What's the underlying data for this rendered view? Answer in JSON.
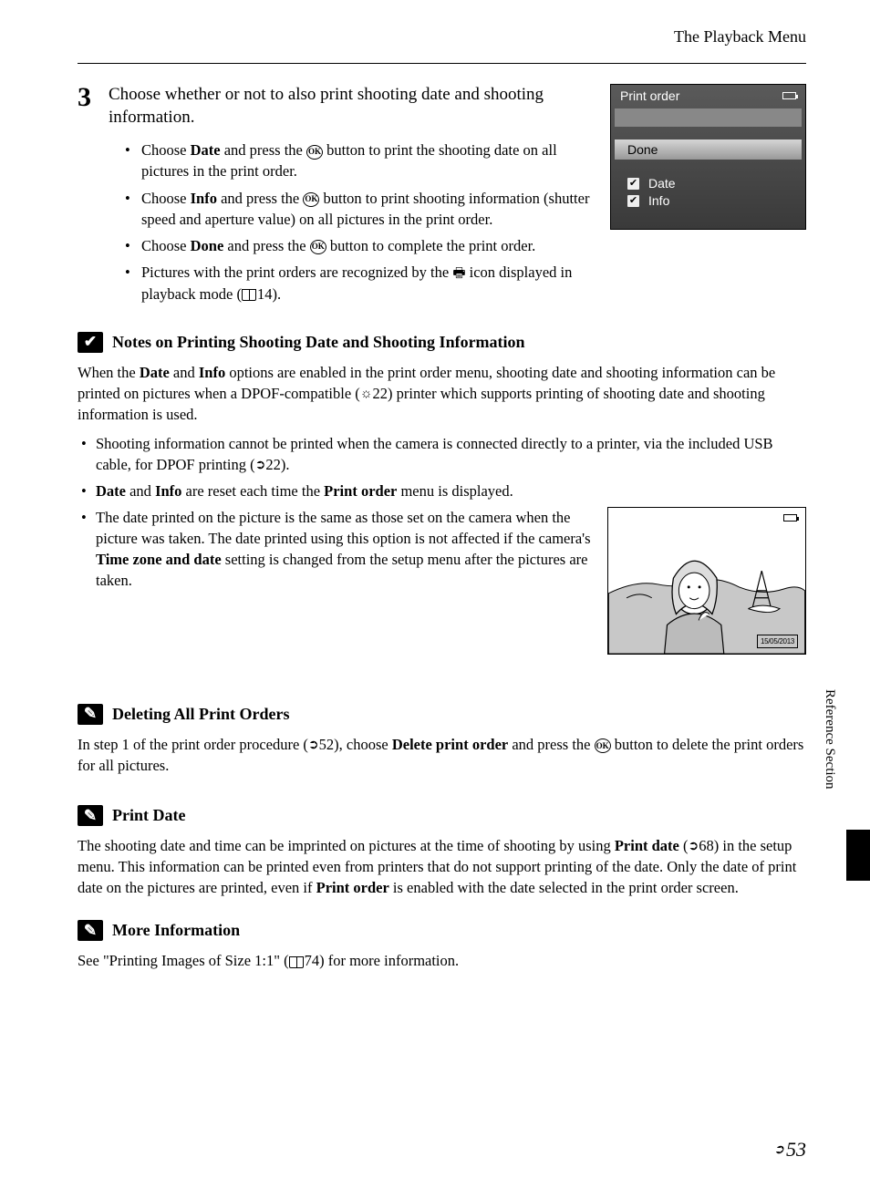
{
  "header": {
    "title": "The Playback Menu"
  },
  "sideTab": "Reference Section",
  "pageNum": "53",
  "step": {
    "number": "3",
    "title": "Choose whether or not to also print shooting date and shooting information.",
    "bullets": {
      "b1_pre": "Choose ",
      "b1_bold": "Date",
      "b1_mid": " and press the ",
      "b1_post": " button to print the shooting date on all pictures in the print order.",
      "b2_pre": "Choose ",
      "b2_bold": "Info",
      "b2_mid": " and press the ",
      "b2_post": " button to print shooting information (shutter speed and aperture value) on all pictures in the print order.",
      "b3_pre": "Choose ",
      "b3_bold": "Done",
      "b3_mid": " and press the ",
      "b3_post": " button to complete the print order.",
      "b4_pre": "Pictures with the print orders are recognized by the ",
      "b4_post": " icon displayed in playback mode (",
      "b4_ref": "14",
      "b4_end": ")."
    }
  },
  "screen": {
    "title": "Print order",
    "done": "Done",
    "date": "Date",
    "info": "Info"
  },
  "note1": {
    "title": "Notes on Printing Shooting Date and Shooting Information",
    "para_pre": "When the ",
    "para_b1": "Date",
    "para_mid1": " and ",
    "para_b2": "Info",
    "para_mid2": " options are enabled in the print order menu, shooting date and shooting information can be printed on pictures when a DPOF-compatible (",
    "para_ref": "22",
    "para_post": ") printer which supports printing of shooting date and shooting information is used.",
    "b1_pre": "Shooting information cannot be printed when the camera is connected directly to a printer, via the included USB cable, for DPOF printing (",
    "b1_ref": "22",
    "b1_post": ").",
    "b2_b1": "Date",
    "b2_mid1": " and ",
    "b2_b2": "Info",
    "b2_mid2": " are reset each time the ",
    "b2_b3": "Print order",
    "b2_post": " menu is displayed.",
    "b3_pre": "The date printed on the picture is the same as those set on the camera when the picture was taken. The date printed using this option is not affected if the camera's ",
    "b3_bold": "Time zone and date",
    "b3_post": " setting is changed from the setup menu after the pictures are taken."
  },
  "photo": {
    "date": "15/05/2013"
  },
  "note2": {
    "title": "Deleting All Print Orders",
    "pre": "In step 1 of the print order procedure (",
    "ref": "52",
    "mid": "), choose ",
    "bold": "Delete print order",
    "mid2": " and press the ",
    "post": " button to delete the print orders for all pictures."
  },
  "note3": {
    "title": "Print Date",
    "pre": "The shooting date and time can be imprinted on pictures at the time of shooting by using ",
    "b1": "Print date",
    "mid1": " (",
    "ref": "68",
    "mid2": ") in the setup menu. This information can be printed even from printers that do not support printing of the date. Only the date of print date on the pictures are printed, even if ",
    "b2": "Print order",
    "post": " is enabled with the date selected in the print order screen."
  },
  "note4": {
    "title": "More Information",
    "pre": "See \"Printing Images of Size 1:1\" (",
    "ref": "74",
    "post": ") for more information."
  },
  "okLabel": "OK"
}
